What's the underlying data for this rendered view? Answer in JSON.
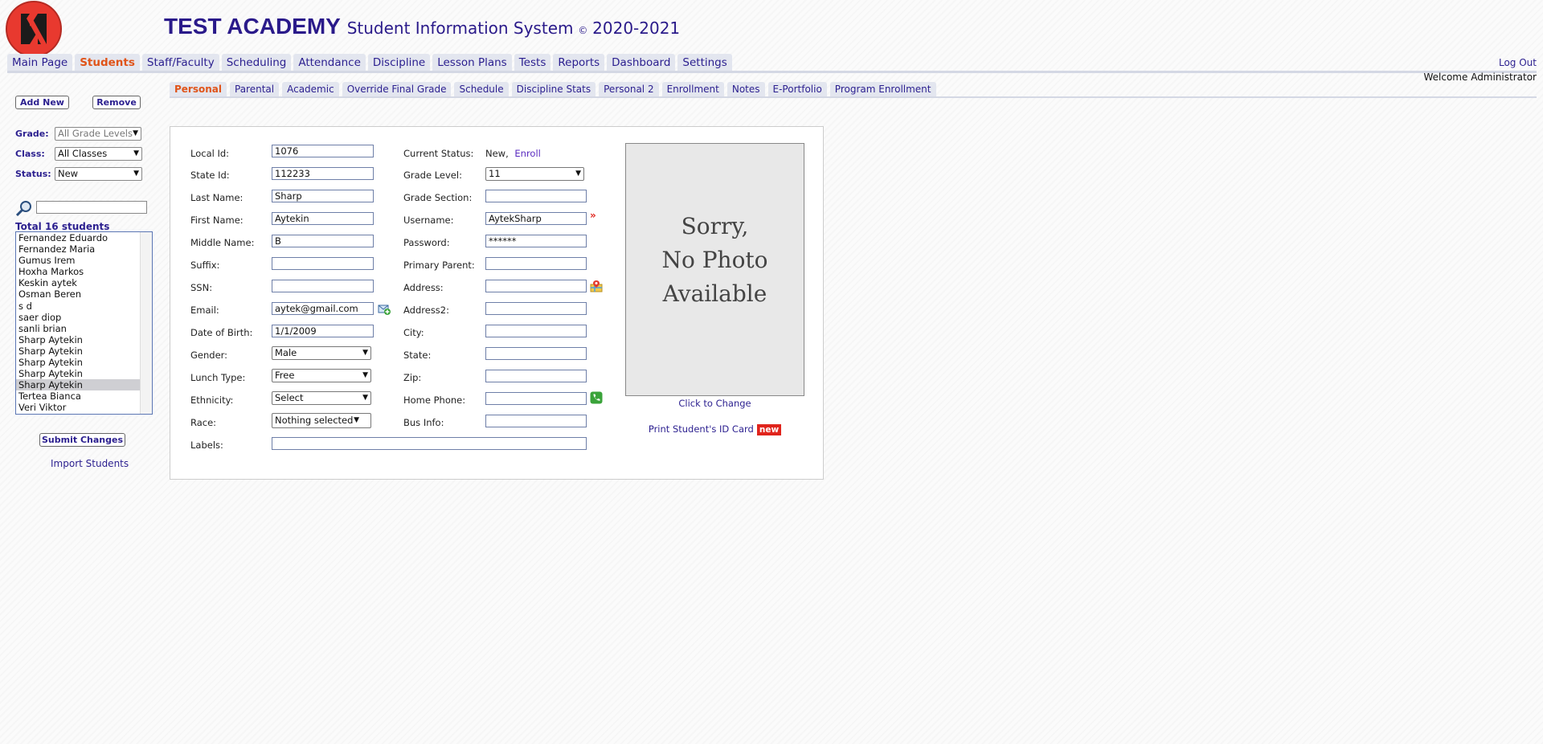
{
  "header": {
    "academy": "TEST ACADEMY",
    "system": "Student Information System",
    "copyright": "©",
    "years": "2020-2021",
    "logout": "Log Out",
    "welcome": "Welcome Administrator"
  },
  "main_nav": [
    "Main Page",
    "Students",
    "Staff/Faculty",
    "Scheduling",
    "Attendance",
    "Discipline",
    "Lesson Plans",
    "Tests",
    "Reports",
    "Dashboard",
    "Settings"
  ],
  "sub_nav": [
    "Personal",
    "Parental",
    "Academic",
    "Override Final Grade",
    "Schedule",
    "Discipline Stats",
    "Personal 2",
    "Enrollment",
    "Notes",
    "E-Portfolio",
    "Program Enrollment"
  ],
  "sidebar": {
    "add_new": "Add New",
    "remove": "Remove",
    "grade_label": "Grade:",
    "grade_value": "All Grade Levels",
    "class_label": "Class:",
    "class_value": "All Classes",
    "status_label": "Status:",
    "status_value": "New",
    "search_value": "",
    "total": "Total 16 students",
    "students": [
      "Fernandez Eduardo",
      "Fernandez Maria",
      "Gumus Irem",
      "Hoxha Markos",
      "Keskin aytek",
      "Osman Beren",
      "s d",
      "saer diop",
      "sanli brian",
      "Sharp Aytekin",
      "Sharp Aytekin",
      "Sharp Aytekin",
      "Sharp Aytekin",
      "Sharp Aytekin",
      "Tertea Bianca",
      "Veri Viktor"
    ],
    "selected_index": 13,
    "submit": "Submit Changes",
    "import": "Import Students"
  },
  "form": {
    "local_id": {
      "label": "Local Id:",
      "value": "1076"
    },
    "state_id": {
      "label": "State Id:",
      "value": "112233"
    },
    "last_name": {
      "label": "Last Name:",
      "value": "Sharp"
    },
    "first_name": {
      "label": "First Name:",
      "value": "Aytekin"
    },
    "middle_name": {
      "label": "Middle Name:",
      "value": "B"
    },
    "suffix": {
      "label": "Suffix:",
      "value": ""
    },
    "ssn": {
      "label": "SSN:",
      "value": ""
    },
    "email": {
      "label": "Email:",
      "value": "aytek@gmail.com"
    },
    "dob": {
      "label": "Date of Birth:",
      "value": "1/1/2009"
    },
    "gender": {
      "label": "Gender:",
      "value": "Male"
    },
    "lunch": {
      "label": "Lunch Type:",
      "value": "Free"
    },
    "ethnicity": {
      "label": "Ethnicity:",
      "value": "Select"
    },
    "race": {
      "label": "Race:",
      "value": "Nothing selected"
    },
    "labels": {
      "label": "Labels:",
      "value": ""
    },
    "current_status": {
      "label": "Current Status:",
      "value": "New,",
      "link": "Enroll"
    },
    "grade_level": {
      "label": "Grade Level:",
      "value": "11"
    },
    "grade_section": {
      "label": "Grade Section:",
      "value": ""
    },
    "username": {
      "label": "Username:",
      "value": "AytekSharp"
    },
    "password": {
      "label": "Password:",
      "value": "******"
    },
    "primary_parent": {
      "label": "Primary Parent:",
      "value": ""
    },
    "address": {
      "label": "Address:",
      "value": ""
    },
    "address2": {
      "label": "Address2:",
      "value": ""
    },
    "city": {
      "label": "City:",
      "value": ""
    },
    "state": {
      "label": "State:",
      "value": ""
    },
    "zip": {
      "label": "Zip:",
      "value": ""
    },
    "home_phone": {
      "label": "Home Phone:",
      "value": ""
    },
    "bus_info": {
      "label": "Bus Info:",
      "value": ""
    },
    "photo_text": "Sorry,\nNo Photo\nAvailable",
    "click_to_change": "Click to Change",
    "print_id": "Print Student's ID Card",
    "new_badge": "new"
  },
  "colors": {
    "accent": "#e0541a",
    "nav_text": "#2b1f8f",
    "brand": "#2a1a8a",
    "logo": "#e8392f"
  },
  "icons": [
    "logo-icon",
    "search-icon",
    "add-email-icon",
    "map-icon",
    "phone-icon",
    "required-marker-icon"
  ]
}
